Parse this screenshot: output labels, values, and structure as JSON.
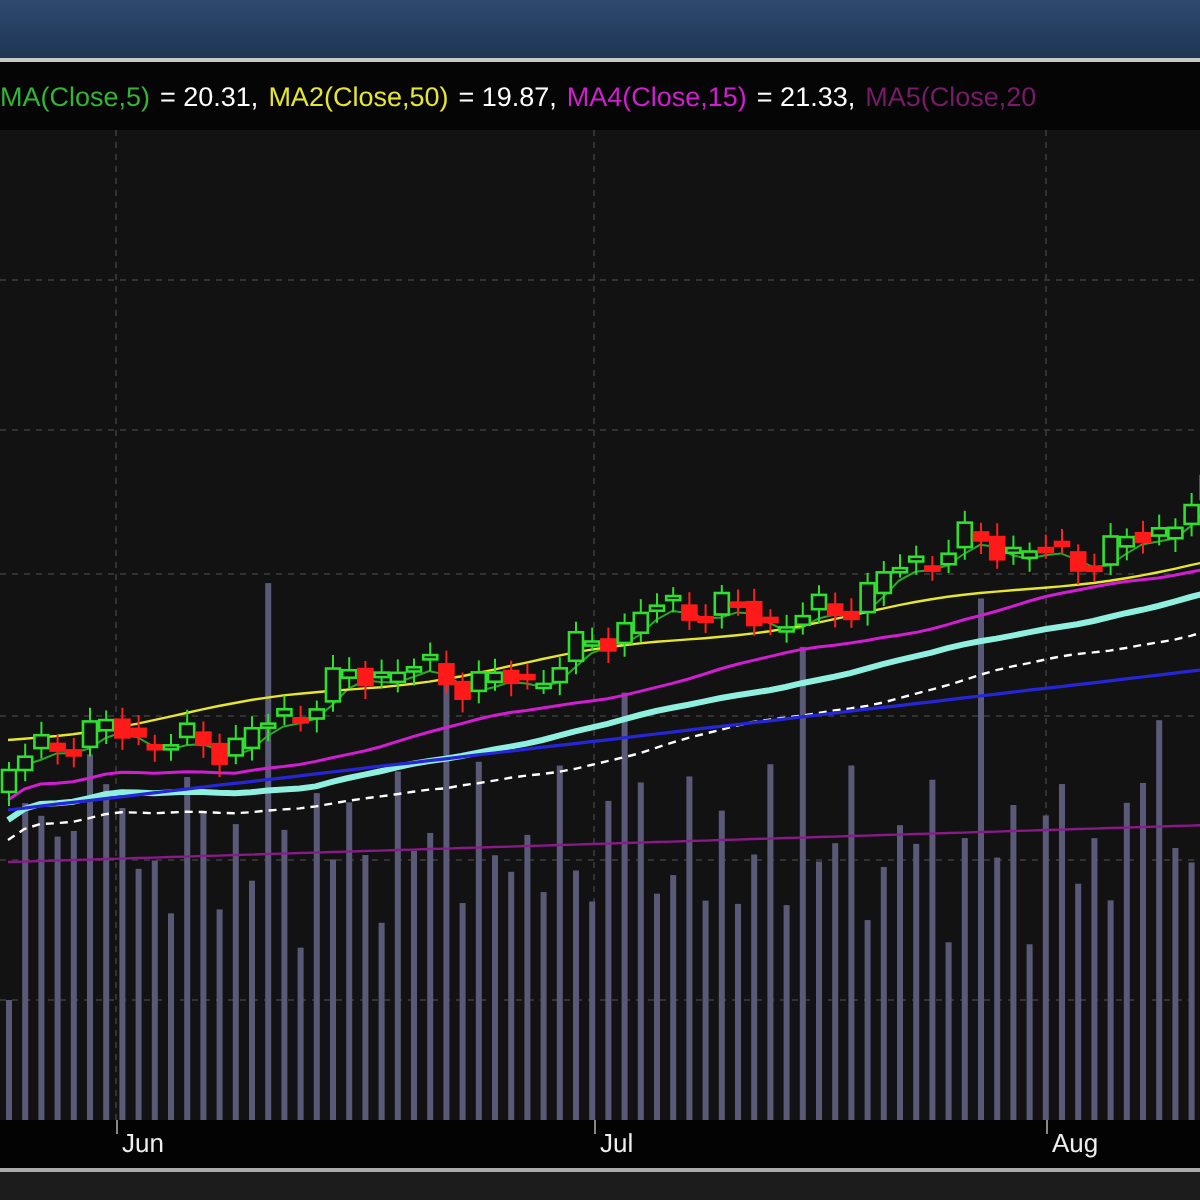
{
  "legend": [
    {
      "label": "MA(Close,5)",
      "color": "#33b533",
      "value": "= 20.31,"
    },
    {
      "label": "MA2(Close,50)",
      "color": "#e6e62e",
      "value": "= 19.87,"
    },
    {
      "label": "MA4(Close,15)",
      "color": "#d21ed2",
      "value": "= 21.33,"
    },
    {
      "label": "MA5(Close,20",
      "color": "#7a1a6a"
    }
  ],
  "x_axis": {
    "labels": [
      "Jun",
      "Jul",
      "Aug"
    ]
  }
}
